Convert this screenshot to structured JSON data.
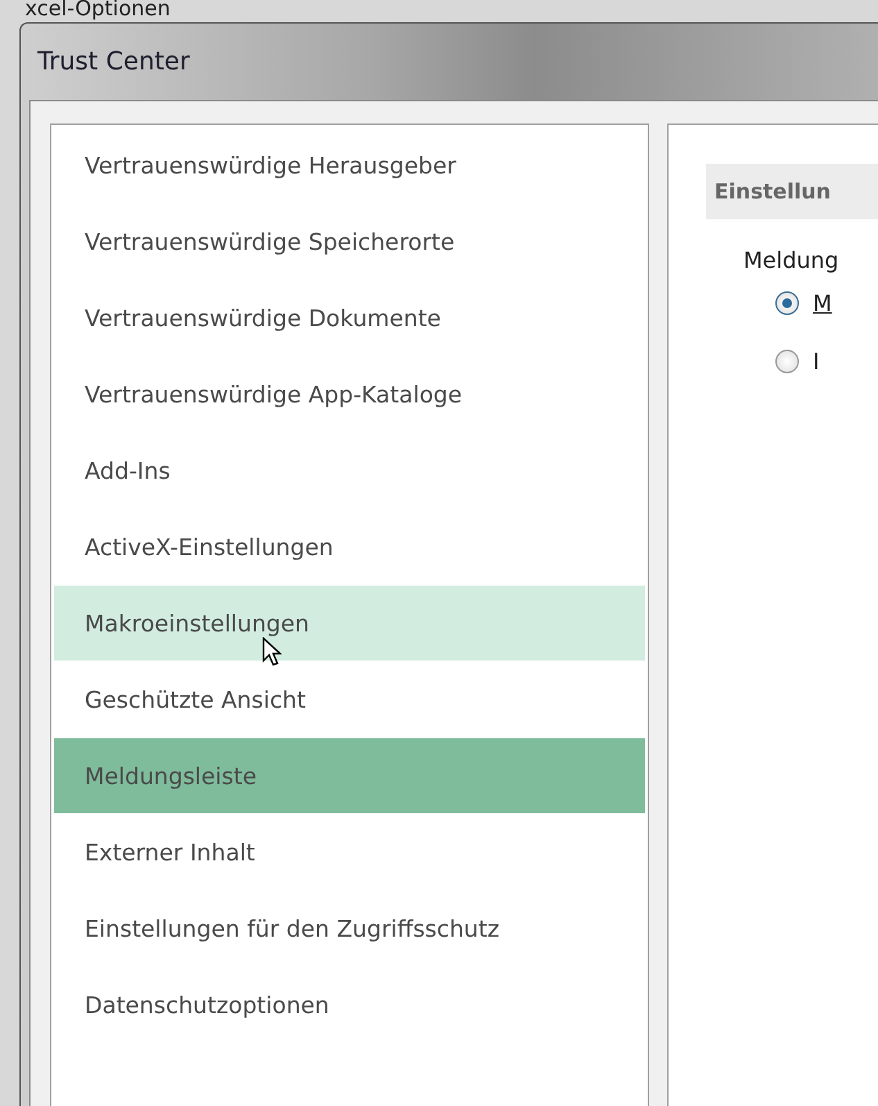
{
  "background_window": {
    "title": "xcel-Optionen"
  },
  "window": {
    "title": "Trust Center"
  },
  "sidebar": {
    "items": [
      {
        "label": "Vertrauenswürdige Herausgeber",
        "selected": false,
        "hovered": false
      },
      {
        "label": "Vertrauenswürdige Speicherorte",
        "selected": false,
        "hovered": false
      },
      {
        "label": "Vertrauenswürdige Dokumente",
        "selected": false,
        "hovered": false
      },
      {
        "label": "Vertrauenswürdige App-Kataloge",
        "selected": false,
        "hovered": false
      },
      {
        "label": "Add-Ins",
        "selected": false,
        "hovered": false
      },
      {
        "label": "ActiveX-Einstellungen",
        "selected": false,
        "hovered": false
      },
      {
        "label": "Makroeinstellungen",
        "selected": false,
        "hovered": true
      },
      {
        "label": "Geschützte Ansicht",
        "selected": false,
        "hovered": false
      },
      {
        "label": "Meldungsleiste",
        "selected": true,
        "hovered": false
      },
      {
        "label": "Externer Inhalt",
        "selected": false,
        "hovered": false
      },
      {
        "label": "Einstellungen für den Zugriffsschutz",
        "selected": false,
        "hovered": false
      },
      {
        "label": "Datenschutzoptionen",
        "selected": false,
        "hovered": false
      }
    ]
  },
  "content": {
    "section_header": "Einstellun",
    "group_label": "Meldung",
    "options": [
      {
        "label": "M",
        "selected": true
      },
      {
        "label": "I",
        "selected": false
      }
    ]
  }
}
